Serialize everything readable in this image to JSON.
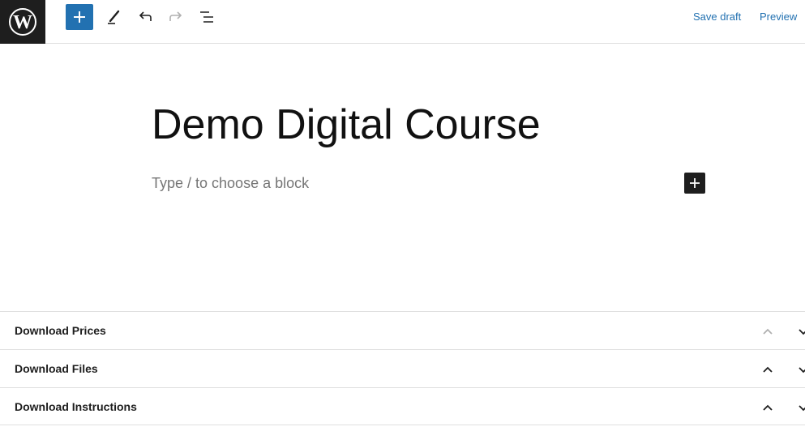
{
  "header": {
    "logo_icon": "wordpress-icon",
    "toolbar": [
      {
        "name": "inserter",
        "icon": "plus-icon"
      },
      {
        "name": "tools",
        "icon": "pencil-icon"
      },
      {
        "name": "undo",
        "icon": "undo-icon"
      },
      {
        "name": "redo",
        "icon": "redo-icon"
      },
      {
        "name": "document-overview",
        "icon": "list-view-icon"
      }
    ],
    "save_draft_label": "Save draft",
    "preview_label": "Preview"
  },
  "editor": {
    "post_title": "Demo Digital Course",
    "block_placeholder": "Type / to choose a block"
  },
  "meta_boxes": [
    {
      "title": "Download Prices",
      "move_up_disabled": true
    },
    {
      "title": "Download Files",
      "move_up_disabled": false
    },
    {
      "title": "Download Instructions",
      "move_up_disabled": false
    }
  ],
  "colors": {
    "accent": "#2271b1",
    "dark": "#1e1e1e",
    "placeholder": "#757575",
    "border": "#e0e0e0"
  }
}
